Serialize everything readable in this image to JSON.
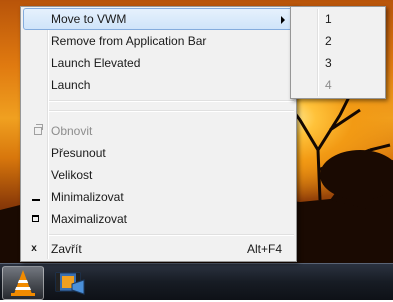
{
  "context_menu": {
    "items": [
      {
        "label": "Move to VWM",
        "has_submenu": true,
        "highlighted": true
      },
      {
        "label": "Remove from Application Bar"
      },
      {
        "label": "Launch Elevated"
      },
      {
        "label": "Launch"
      }
    ],
    "system_items": [
      {
        "label": "Obnovit",
        "icon": "restore-icon",
        "disabled": true
      },
      {
        "label": "Přesunout"
      },
      {
        "label": "Velikost"
      },
      {
        "label": "Minimalizovat",
        "icon": "minimize-icon"
      },
      {
        "label": "Maximalizovat",
        "icon": "maximize-icon"
      }
    ],
    "close_item": {
      "label": "Zavřít",
      "icon_glyph": "x",
      "shortcut": "Alt+F4"
    }
  },
  "submenu": {
    "items": [
      {
        "label": "1"
      },
      {
        "label": "2"
      },
      {
        "label": "3"
      },
      {
        "label": "4",
        "disabled": true
      }
    ]
  },
  "taskbar": {
    "buttons": [
      {
        "name": "vlc-icon",
        "active": true
      },
      {
        "name": "movie-maker-icon",
        "active": false
      }
    ]
  }
}
